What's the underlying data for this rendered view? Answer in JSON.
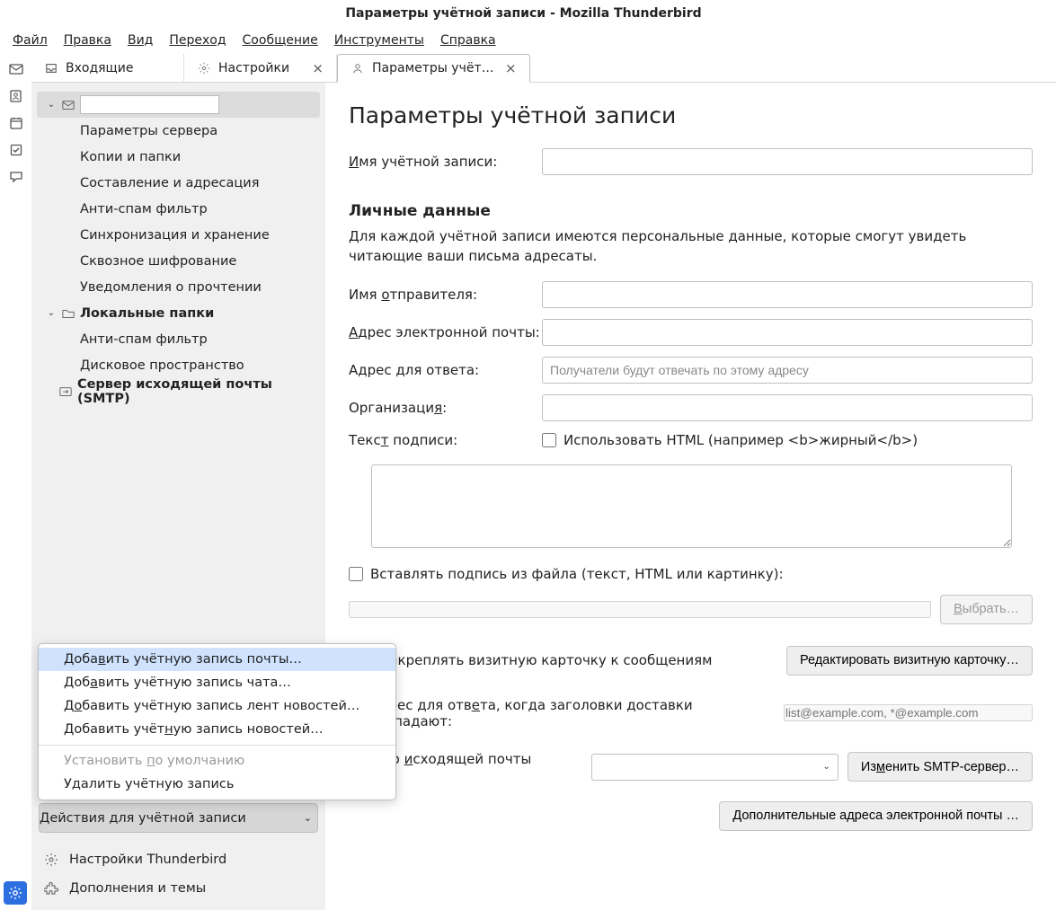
{
  "titlebar": "Параметры учётной записи - Mozilla Thunderbird",
  "menu": [
    "Файл",
    "Правка",
    "Вид",
    "Переход",
    "Сообщение",
    "Инструменты",
    "Справка"
  ],
  "tabs": [
    {
      "label": "Входящие",
      "closable": false
    },
    {
      "label": "Настройки",
      "closable": true
    },
    {
      "label": "Параметры учётной з",
      "closable": true,
      "active": true
    }
  ],
  "tree": {
    "account_items": [
      "Параметры сервера",
      "Копии и папки",
      "Составление и адресация",
      "Анти-спам фильтр",
      "Синхронизация и хранение",
      "Сквозное шифрование",
      "Уведомления о прочтении"
    ],
    "local_label": "Локальные папки",
    "local_items": [
      "Анти-спам фильтр",
      "Дисковое пространство"
    ],
    "smtp_label": "Сервер исходящей почты (SMTP)"
  },
  "sidebar_actions": {
    "actions_btn": "Действия для учётной записи",
    "settings_link": "Настройки Thunderbird",
    "addons_link": "Дополнения и темы"
  },
  "popup": {
    "items": [
      {
        "text": "Добавить учётную запись почты…",
        "hl": true
      },
      {
        "text": "Добавить учётную запись чата…"
      },
      {
        "text": "Добавить учётную запись лент новостей…"
      },
      {
        "text": "Добавить учётную запись новостей…"
      }
    ],
    "set_default": "Установить по умолчанию",
    "delete": "Удалить учётную запись"
  },
  "content": {
    "title": "Параметры учётной записи",
    "account_name_label": "Имя учётной записи:",
    "section_personal": "Личные данные",
    "personal_desc": "Для каждой учётной записи имеются персональные данные, которые смогут увидеть читающие ваши письма адресаты.",
    "sender_name": "Имя отправителя:",
    "email": "Адрес электронной почты:",
    "reply_to": "Адрес для ответа:",
    "reply_to_placeholder": "Получатели будут отвечать по этому адресу",
    "org": "Организация:",
    "sig_text": "Текст подписи:",
    "use_html": "Использовать HTML (например <b>жирный</b>)",
    "attach_sig_file": "Вставлять подпись из файла (текст, HTML или картинку):",
    "choose": "Выбрать…",
    "attach_vcard": "Прикреплять визитную карточку к сообщениям",
    "edit_vcard": "Редактировать визитную карточку…",
    "reply_head": "Адрес для ответа, когда заголовки доставки совпадают:",
    "reply_head_placeholder": "list@example.com, *@example.com",
    "smtp_label": "Сервер исходящей почты (SMTP)",
    "edit_smtp": "Изменить SMTP-сервер…",
    "more_emails": "Дополнительные адреса электронной почты …"
  }
}
